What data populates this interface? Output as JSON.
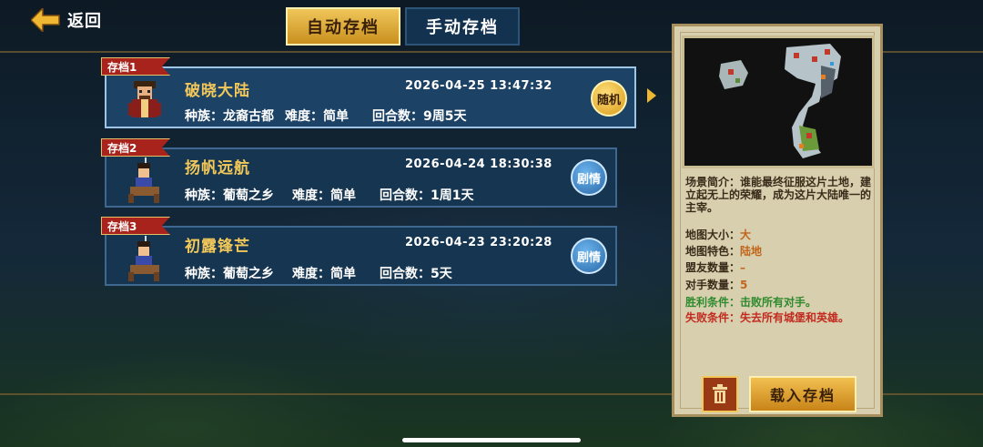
{
  "header": {
    "back_label": "返回"
  },
  "tabs": [
    {
      "label": "自动存档",
      "active": true
    },
    {
      "label": "手动存档",
      "active": false
    }
  ],
  "saves": [
    {
      "tag": "存档1",
      "name": "破晓大陆",
      "time": "2026-04-25 13:47:32",
      "race": "种族：龙裔古都",
      "difficulty": "难度：简单",
      "turns": "回合数：9周5天",
      "badge": "随机"
    },
    {
      "tag": "存档2",
      "name": "扬帆远航",
      "time": "2026-04-24 18:30:38",
      "race": "种族：葡萄之乡",
      "difficulty": "难度：简单",
      "turns": "回合数：1周1天",
      "badge": "剧情"
    },
    {
      "tag": "存档3",
      "name": "初露锋芒",
      "time": "2026-04-23 23:20:28",
      "race": "种族：葡萄之乡",
      "difficulty": "难度：简单",
      "turns": "回合数：5天",
      "badge": "剧情"
    }
  ],
  "detail": {
    "description": "场景简介：谁能最终征服这片土地，建立起无上的荣耀，成为这片大陆唯一的主宰。",
    "map_size_label": "地图大小：",
    "map_size": "大",
    "map_feature_label": "地图特色：",
    "map_feature": "陆地",
    "allies_label": "盟友数量：",
    "allies": "–",
    "opponents_label": "对手数量：",
    "opponents": "5",
    "win_condition": "胜利条件：击败所有对手。",
    "lose_condition": "失败条件：失去所有城堡和英雄。",
    "load_label": "载入存档"
  },
  "colors": {
    "accent_gold": "#f2c85a",
    "win_green": "#2e8a2e",
    "lose_red": "#c22a20",
    "tag_red": "#a8231b"
  },
  "icons": {
    "back": "back-arrow-icon",
    "delete": "trash-icon",
    "selected": "selection-arrow-icon"
  }
}
